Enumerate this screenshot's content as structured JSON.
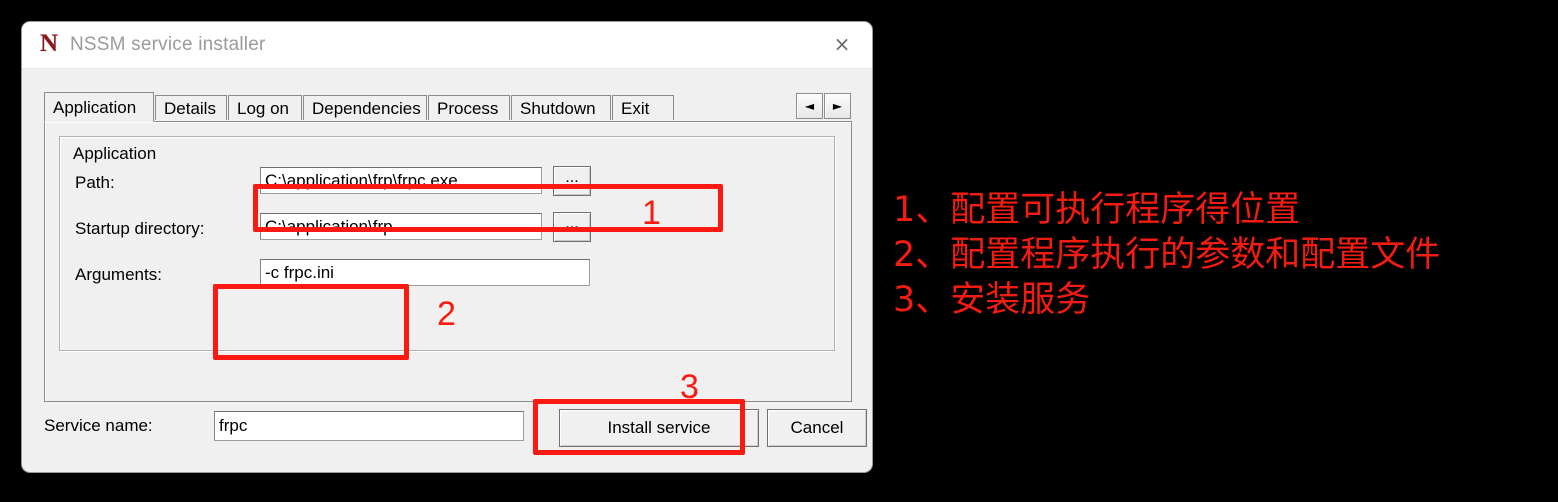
{
  "window": {
    "title": "NSSM service installer",
    "icon": "N",
    "icon_name": "nssm-logo-icon",
    "close_icon": "×"
  },
  "tabs": [
    {
      "label": "Application",
      "active": true
    },
    {
      "label": "Details",
      "active": false
    },
    {
      "label": "Log on",
      "active": false
    },
    {
      "label": "Dependencies",
      "active": false
    },
    {
      "label": "Process",
      "active": false
    },
    {
      "label": "Shutdown",
      "active": false
    },
    {
      "label": "Exit",
      "active": false
    }
  ],
  "tab_scroll": {
    "left_arrow": "◄",
    "right_arrow": "►"
  },
  "group": {
    "legend": "Application",
    "fields": [
      {
        "label": "Path:",
        "value": "C:\\application\\frp\\frpc.exe",
        "browse": "..."
      },
      {
        "label": "Startup directory:",
        "value": "C:\\application\\frp",
        "browse": "..."
      },
      {
        "label": "Arguments:",
        "value": "-c frpc.ini",
        "browse": ""
      }
    ]
  },
  "footer": {
    "service_name_label": "Service name:",
    "service_name_value": "frpc",
    "install_button": "Install service",
    "cancel_button": "Cancel"
  },
  "annotations": {
    "markers": [
      "1",
      "2",
      "3"
    ],
    "color": "#fb1a11",
    "notes": [
      "1、配置可执行程序得位置",
      "2、配置程序执行的参数和配置文件",
      "3、安装服务"
    ]
  }
}
